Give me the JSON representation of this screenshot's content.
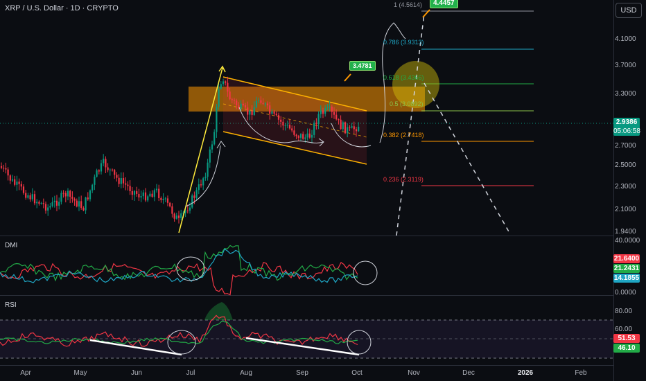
{
  "header": {
    "title": "XRP / U.S. Dollar · 1D · CRYPTO"
  },
  "currency_button": "USD",
  "price_axis": [
    "4.1000",
    "3.7000",
    "3.3000",
    "2.7000",
    "2.5000",
    "2.3000",
    "2.1000",
    "1.9400"
  ],
  "price_tag": {
    "price": "2.9386",
    "countdown": "05:06:58",
    "color": "#089981"
  },
  "dmi": {
    "title": "DMI",
    "axis": [
      "40.0000",
      "0.0000"
    ],
    "values": [
      {
        "text": "21.6400",
        "color": "#f23645"
      },
      {
        "text": "21.2431",
        "color": "#22ab47"
      },
      {
        "text": "14.1855",
        "color": "#1fa6c4"
      }
    ]
  },
  "rsi": {
    "title": "RSI",
    "axis": [
      "80.00",
      "60.00"
    ],
    "values": [
      {
        "text": "51.53",
        "color": "#f23645"
      },
      {
        "text": "46.10",
        "color": "#22ab47"
      }
    ]
  },
  "x_axis": [
    "Apr",
    "May",
    "Jun",
    "Jul",
    "Aug",
    "Sep",
    "Oct",
    "Nov",
    "Dec",
    "2026",
    "Feb"
  ],
  "fib_levels": [
    {
      "text": "1 (4.5614)",
      "color": "#9598a1"
    },
    {
      "text": "0.786 (3.9313)",
      "color": "#1fa6c4"
    },
    {
      "text": "0.618 (3.4366)",
      "color": "#22ab47"
    },
    {
      "text": "0.5 (3.0892)",
      "color": "#8bc34a"
    },
    {
      "text": "0.382 (2.7418)",
      "color": "#ff9800"
    },
    {
      "text": "0.236 (2.3119)",
      "color": "#f23645"
    }
  ],
  "callouts": {
    "high": "4.4457",
    "mid": "3.4781"
  },
  "colors": {
    "up": "#089981",
    "down": "#f23645",
    "background": "#0b0d12"
  }
}
